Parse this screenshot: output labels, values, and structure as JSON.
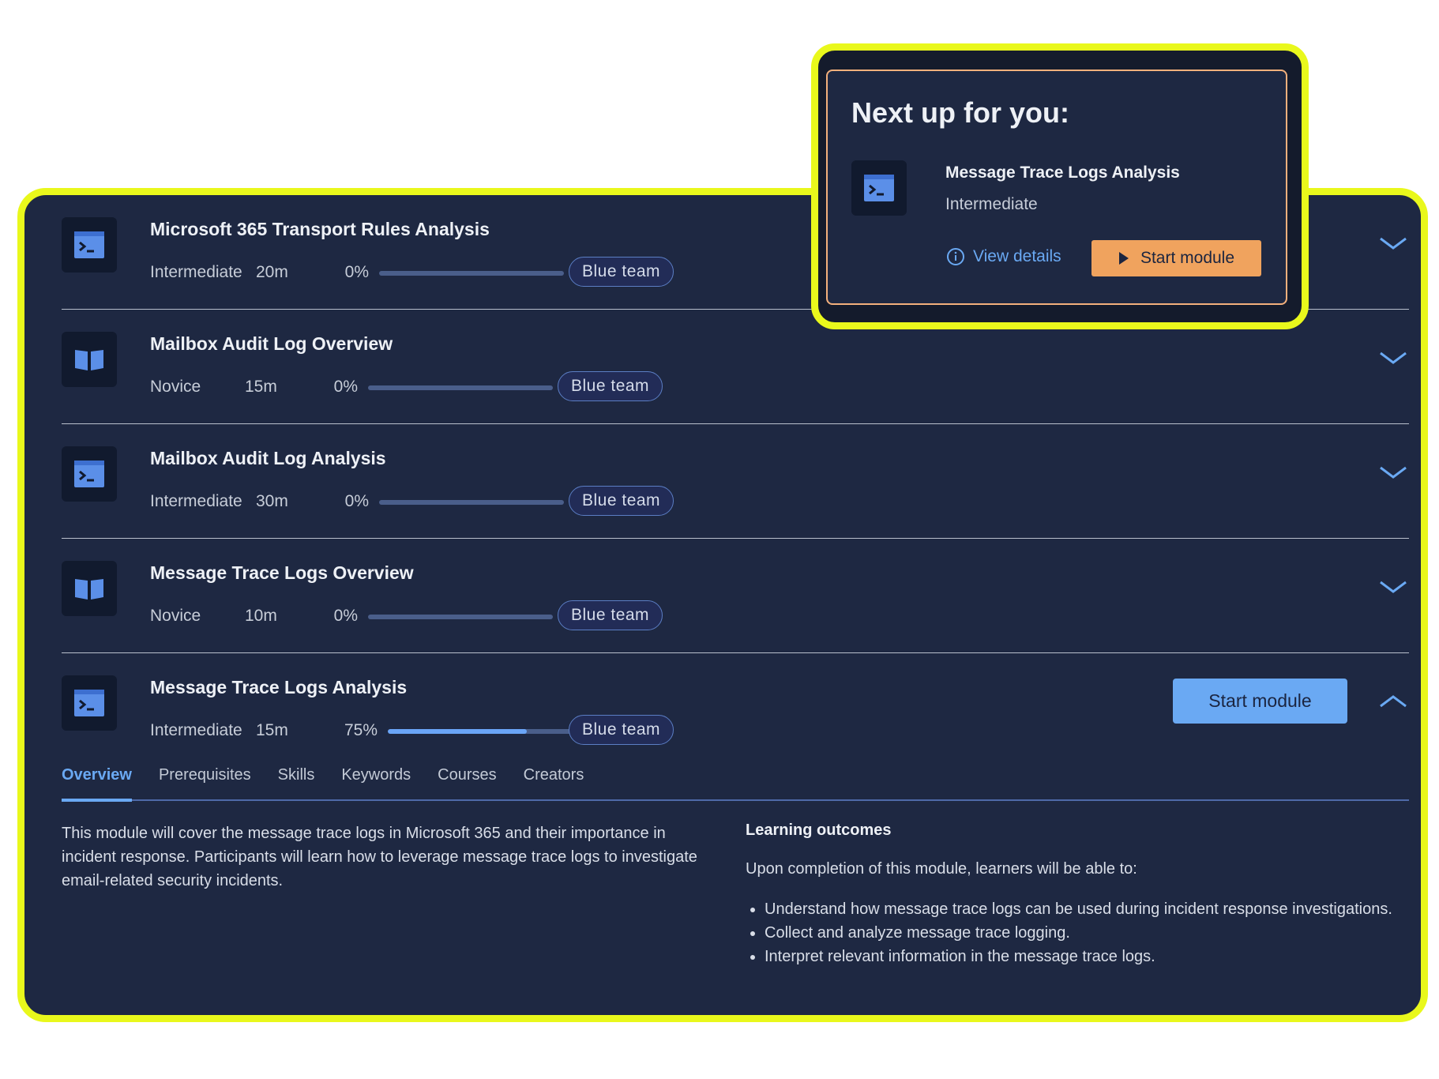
{
  "modules": [
    {
      "title": "Microsoft 365 Transport Rules Analysis",
      "icon": "terminal-icon",
      "level": "Intermediate",
      "duration": "20m",
      "progress_label": "0%",
      "progress": 0,
      "tag": "Blue team",
      "expanded": false
    },
    {
      "title": "Mailbox Audit Log Overview",
      "icon": "book-icon",
      "level": "Novice",
      "duration": "15m",
      "progress_label": "0%",
      "progress": 0,
      "tag": "Blue team",
      "expanded": false
    },
    {
      "title": "Mailbox Audit Log Analysis",
      "icon": "terminal-icon",
      "level": "Intermediate",
      "duration": "30m",
      "progress_label": "0%",
      "progress": 0,
      "tag": "Blue team",
      "expanded": false
    },
    {
      "title": "Message Trace Logs Overview",
      "icon": "book-icon",
      "level": "Novice",
      "duration": "10m",
      "progress_label": "0%",
      "progress": 0,
      "tag": "Blue team",
      "expanded": false
    },
    {
      "title": "Message Trace Logs Analysis",
      "icon": "terminal-icon",
      "level": "Intermediate",
      "duration": "15m",
      "progress_label": "75%",
      "progress": 75,
      "tag": "Blue team",
      "expanded": true,
      "start_label": "Start module"
    }
  ],
  "tabs": [
    "Overview",
    "Prerequisites",
    "Skills",
    "Keywords",
    "Courses",
    "Creators"
  ],
  "active_tab": "Overview",
  "overview": {
    "description": "This module will cover the message trace logs in Microsoft 365 and their importance in incident response. Participants will learn how to leverage message trace logs to investigate email-related security incidents.",
    "outcomes_heading": "Learning outcomes",
    "outcomes_intro": "Upon completion of this module, learners will be able to:",
    "outcomes": [
      "Understand how message trace logs can be used during incident response investigations.",
      "Collect and analyze message trace logging.",
      "Interpret relevant information in the message trace logs."
    ]
  },
  "next_up": {
    "heading": "Next up for you:",
    "title": "Message Trace Logs Analysis",
    "level": "Intermediate",
    "view_details": "View details",
    "start_label": "Start module"
  },
  "colors": {
    "panel_bg": "#1e2842",
    "highlight": "#e9f81c",
    "accent": "#6aa9f3",
    "orange": "#f0a35e"
  }
}
